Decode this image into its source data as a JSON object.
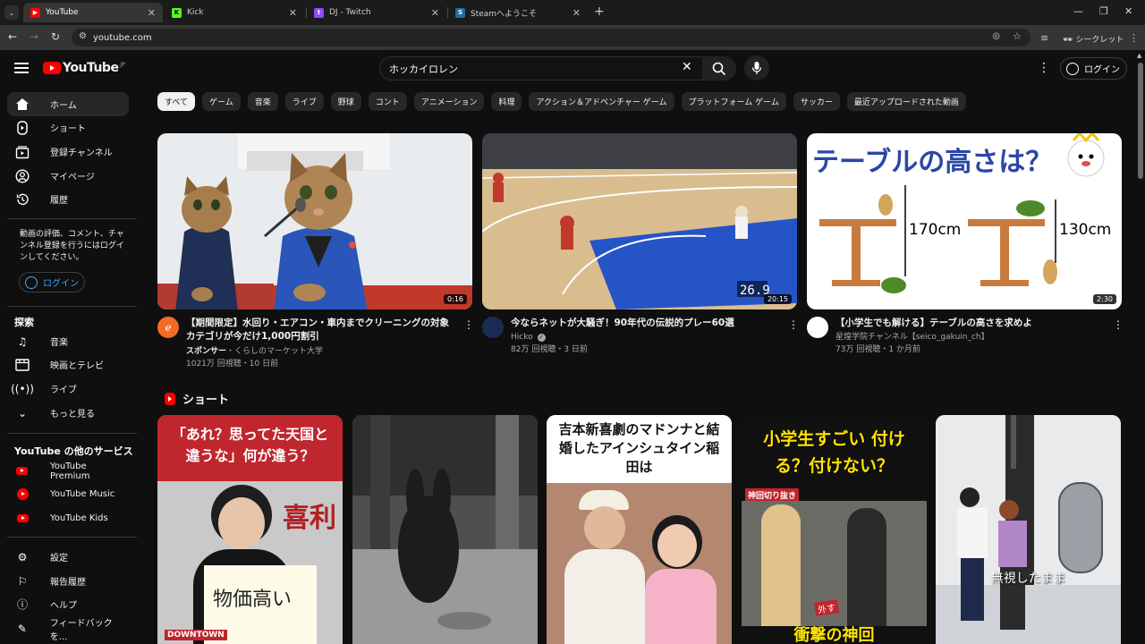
{
  "browser": {
    "tabs": [
      {
        "title": "YouTube",
        "color": "#ff0000",
        "glyph": "▶"
      },
      {
        "title": "Kick",
        "color": "#53fc18",
        "glyph": "K"
      },
      {
        "title": "DJ - Twitch",
        "color": "#9146ff",
        "glyph": "t"
      },
      {
        "title": "Steamへようこそ",
        "color": "#1b6fa8",
        "glyph": "S"
      }
    ],
    "url": "youtube.com",
    "incognito_label": "シークレット"
  },
  "header": {
    "logo_text": "YouTube",
    "logo_region": "JP",
    "search_value": "ホッカイロレン",
    "signin_label": "ログイン"
  },
  "sidebar": {
    "main": [
      {
        "label": "ホーム"
      },
      {
        "label": "ショート"
      },
      {
        "label": "登録チャンネル"
      },
      {
        "label": "マイページ"
      },
      {
        "label": "履歴"
      }
    ],
    "signin_note": "動画の評価、コメント、チャンネル登録を行うにはログインしてください。",
    "signin_button": "ログイン",
    "explore_title": "探索",
    "explore": [
      {
        "label": "音楽"
      },
      {
        "label": "映画とテレビ"
      },
      {
        "label": "ライブ"
      },
      {
        "label": "もっと見る"
      }
    ],
    "services_title": "YouTube の他のサービス",
    "services": [
      {
        "label": "YouTube Premium"
      },
      {
        "label": "YouTube Music"
      },
      {
        "label": "YouTube Kids"
      }
    ],
    "footer": [
      {
        "label": "設定"
      },
      {
        "label": "報告履歴"
      },
      {
        "label": "ヘルプ"
      },
      {
        "label": "フィードバックを..."
      }
    ]
  },
  "chips": [
    "すべて",
    "ゲーム",
    "音楽",
    "ライブ",
    "野球",
    "コント",
    "アニメーション",
    "料理",
    "アクション＆アドベンチャー ゲーム",
    "プラットフォーム ゲーム",
    "サッカー",
    "最近アップロードされた動画"
  ],
  "videos": [
    {
      "title": "【期間限定】水回り・エアコン・車内までクリーニングの対象カテゴリが今だけ1,000円割引",
      "channel": "スポンサー・くらしのマーケット大学",
      "channel_prefix": "スポンサー",
      "channel_name": "・くらしのマーケット大学",
      "meta": "1021万 回視聴・10 日前",
      "duration": "0:16"
    },
    {
      "title": "今ならネットが大騒ぎ！90年代の伝説的プレー60選",
      "channel": "Hicko",
      "meta": "82万 回視聴・3 日前",
      "duration": "20:15",
      "score": "26.9"
    },
    {
      "title": "【小学生でも解ける】テーブルの高さを求めよ",
      "channel": "星煌学院チャンネル【seico_gakuin_ch】",
      "meta": "73万 回視聴・1 か月前",
      "duration": "2:30",
      "thumb_title": "テーブルの高さは？",
      "thumb_left": "170cm",
      "thumb_right": "130cm"
    }
  ],
  "shorts_title": "ショート",
  "shorts": [
    {
      "caption": "「あれ？思ってた天国と違うな」何が違う？",
      "board": "物価高い",
      "sign": "喜利",
      "badge": "DOWNTOWN"
    },
    {
      "caption": ""
    },
    {
      "caption": "吉本新喜劇のマドンナと結婚したアインシュタイン稲田は"
    },
    {
      "caption": "小学生すごい 付ける？付けない？",
      "tag": "神回切り抜き",
      "bottom": "衝撃の神回",
      "small": "外す"
    },
    {
      "caption": "無視したまま"
    }
  ]
}
